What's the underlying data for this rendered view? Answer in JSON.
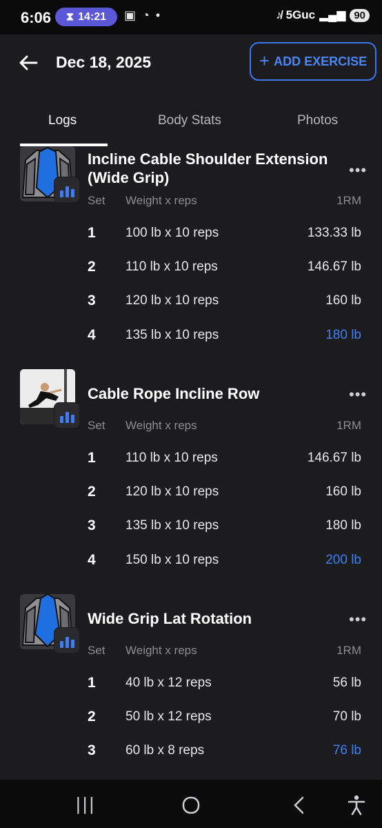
{
  "status_bar": {
    "time": "6:06",
    "timer": "14:21",
    "network": "5Guc",
    "battery": "90"
  },
  "header": {
    "title": "Dec 18, 2025",
    "add_label": "ADD EXERCISE"
  },
  "tabs": [
    {
      "label": "Logs",
      "active": true
    },
    {
      "label": "Body Stats",
      "active": false
    },
    {
      "label": "Photos",
      "active": false
    }
  ],
  "table_headers": {
    "set": "Set",
    "weight": "Weight x reps",
    "rm": "1RM"
  },
  "exercises": [
    {
      "name": "Incline Cable Shoulder Extension (Wide Grip)",
      "thumb": "muscle-diagram",
      "sets": [
        {
          "set": "1",
          "weight": "100 lb x 10 reps",
          "rm": "133.33 lb"
        },
        {
          "set": "2",
          "weight": "110 lb x 10 reps",
          "rm": "146.67 lb"
        },
        {
          "set": "3",
          "weight": "120 lb x 10 reps",
          "rm": "160 lb"
        },
        {
          "set": "4",
          "weight": "135 lb x 10 reps",
          "rm": "180 lb",
          "best": true
        }
      ]
    },
    {
      "name": "Cable Rope Incline Row",
      "thumb": "photo",
      "sets": [
        {
          "set": "1",
          "weight": "110 lb x 10 reps",
          "rm": "146.67 lb"
        },
        {
          "set": "2",
          "weight": "120 lb x 10 reps",
          "rm": "160 lb"
        },
        {
          "set": "3",
          "weight": "135 lb x 10 reps",
          "rm": "180 lb"
        },
        {
          "set": "4",
          "weight": "150 lb x 10 reps",
          "rm": "200 lb",
          "best": true
        }
      ]
    },
    {
      "name": "Wide Grip Lat Rotation",
      "thumb": "muscle-diagram",
      "sets": [
        {
          "set": "1",
          "weight": "40 lb x 12 reps",
          "rm": "56 lb"
        },
        {
          "set": "2",
          "weight": "50 lb x 12 reps",
          "rm": "70 lb"
        },
        {
          "set": "3",
          "weight": "60 lb x 8 reps",
          "rm": "76 lb",
          "best": true
        }
      ]
    }
  ],
  "colors": {
    "accent": "#3b78f0",
    "background": "#1c1c1e"
  }
}
